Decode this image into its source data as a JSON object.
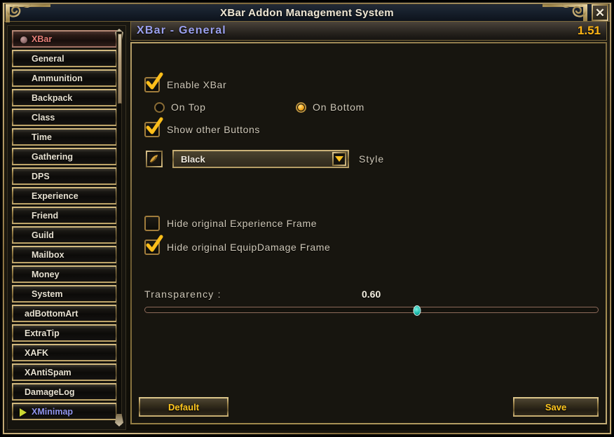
{
  "window": {
    "title": "XBar Addon Management System",
    "close_label": "✕"
  },
  "sidebar": {
    "items": [
      {
        "label": "XBar",
        "state": "selected"
      },
      {
        "label": "General",
        "state": "normal"
      },
      {
        "label": "Ammunition",
        "state": "normal"
      },
      {
        "label": "Backpack",
        "state": "normal"
      },
      {
        "label": "Class",
        "state": "normal"
      },
      {
        "label": "Time",
        "state": "normal"
      },
      {
        "label": "Gathering",
        "state": "normal"
      },
      {
        "label": "DPS",
        "state": "normal"
      },
      {
        "label": "Experience",
        "state": "normal"
      },
      {
        "label": "Friend",
        "state": "normal"
      },
      {
        "label": "Guild",
        "state": "normal"
      },
      {
        "label": "Mailbox",
        "state": "normal"
      },
      {
        "label": "Money",
        "state": "normal"
      },
      {
        "label": "System",
        "state": "normal"
      },
      {
        "label": "adBottomArt",
        "state": "wide"
      },
      {
        "label": "ExtraTip",
        "state": "wide"
      },
      {
        "label": "XAFK",
        "state": "wide"
      },
      {
        "label": "XAntiSpam",
        "state": "wide"
      },
      {
        "label": "DamageLog",
        "state": "wide"
      },
      {
        "label": "XMinimap",
        "state": "active"
      }
    ]
  },
  "panel": {
    "title": "XBar - General",
    "version": "1.51"
  },
  "options": {
    "enable_xbar": {
      "label": "Enable XBar",
      "checked": true
    },
    "position": {
      "on_top": {
        "label": "On Top",
        "selected": false
      },
      "on_bottom": {
        "label": "On Bottom",
        "selected": true
      }
    },
    "show_other_buttons": {
      "label": "Show other Buttons",
      "checked": true
    },
    "style": {
      "value": "Black",
      "side_label": "Style",
      "icon": "style-swatch-icon",
      "arrow_icon": "chevron-down-icon"
    },
    "hide_experience_frame": {
      "label": "Hide original Experience Frame",
      "checked": false
    },
    "hide_equipdamage_frame": {
      "label": "Hide original EquipDamage Frame",
      "checked": true
    },
    "transparency": {
      "label": "Transparency :",
      "value": "0.60",
      "percent": 60
    }
  },
  "footer": {
    "default_label": "Default",
    "save_label": "Save"
  },
  "colors": {
    "gold": "#ffc61e",
    "title_blue": "#9aa0ee",
    "selected_red": "#e87f78",
    "active_blue": "#8f93ec",
    "slider_knob": "#17b6a8"
  }
}
